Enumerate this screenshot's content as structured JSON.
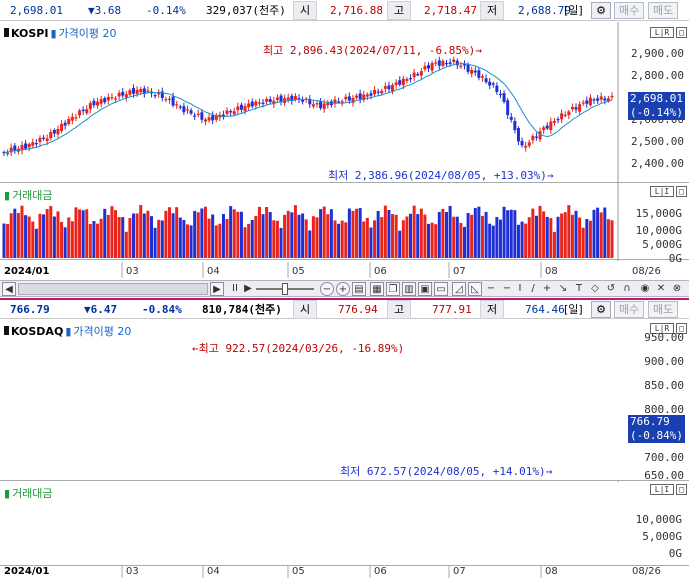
{
  "kospi": {
    "info": {
      "price": "2,698.01",
      "change": "▼3.68",
      "pct": "-0.14%",
      "volume": "329,037(천주)",
      "open_lbl": "시",
      "open": "2,716.88",
      "high_lbl": "고",
      "high": "2,718.47",
      "low_lbl": "저",
      "low": "2,688.79",
      "period": "[일]",
      "gear": "⚙",
      "buy": "매수",
      "sell": "매도"
    },
    "name": "KOSPI",
    "indicator": "가격이평 20",
    "yaxis": [
      "2,900.00",
      "2,800.00",
      "2,700.00",
      "2,600.00",
      "2,500.00",
      "2,400.00"
    ],
    "cur_price": "2,698.01",
    "cur_pct": "(-0.14%)",
    "high_anno": "최고 2,896.43(2024/07/11, -6.85%)→",
    "low_anno": "최저 2,386.96(2024/08/05, +13.03%)→",
    "vol_title": "거래대금",
    "vol_axis": [
      "15,000G",
      "10,000G",
      "5,000G",
      "0G"
    ],
    "xaxis_start": "2024/01",
    "xaxis": [
      "03",
      "04",
      "05",
      "06",
      "07",
      "08"
    ],
    "xaxis_end": "08/26"
  },
  "kosdaq": {
    "info": {
      "price": "766.79",
      "change": "▼6.47",
      "pct": "-0.84%",
      "volume": "810,784(천주)",
      "open_lbl": "시",
      "open": "776.94",
      "high_lbl": "고",
      "high": "777.91",
      "low_lbl": "저",
      "low": "764.46",
      "period": "[일]",
      "gear": "⚙",
      "buy": "매수",
      "sell": "매도"
    },
    "name": "KOSDAQ",
    "indicator": "가격이평 20",
    "yaxis": [
      "950.00",
      "900.00",
      "850.00",
      "800.00",
      "750.00",
      "700.00",
      "650.00"
    ],
    "cur_price": "766.79",
    "cur_pct": "(-0.84%)",
    "high_anno": "←최고 922.57(2024/03/26, -16.89%)",
    "low_anno": "최저 672.57(2024/08/05, +14.01%)→",
    "vol_title": "거래대금",
    "vol_axis": [
      "10,000G",
      "5,000G",
      "0G"
    ],
    "xaxis_start": "2024/01",
    "xaxis": [
      "03",
      "04",
      "05",
      "06",
      "07",
      "08"
    ],
    "xaxis_end": "08/26"
  },
  "toolbar": {
    "left": "◀",
    "right": "▶",
    "pause": "II",
    "play": "▶",
    "minus": "−",
    "plus": "+",
    "pipe": "I",
    "text_tool": "T"
  },
  "mini_labels": {
    "lr": "L|R",
    "li": "L|I"
  },
  "colors": {
    "up": "#e8241c",
    "down": "#1e2fd6",
    "ma": "#1a8fd0"
  }
}
